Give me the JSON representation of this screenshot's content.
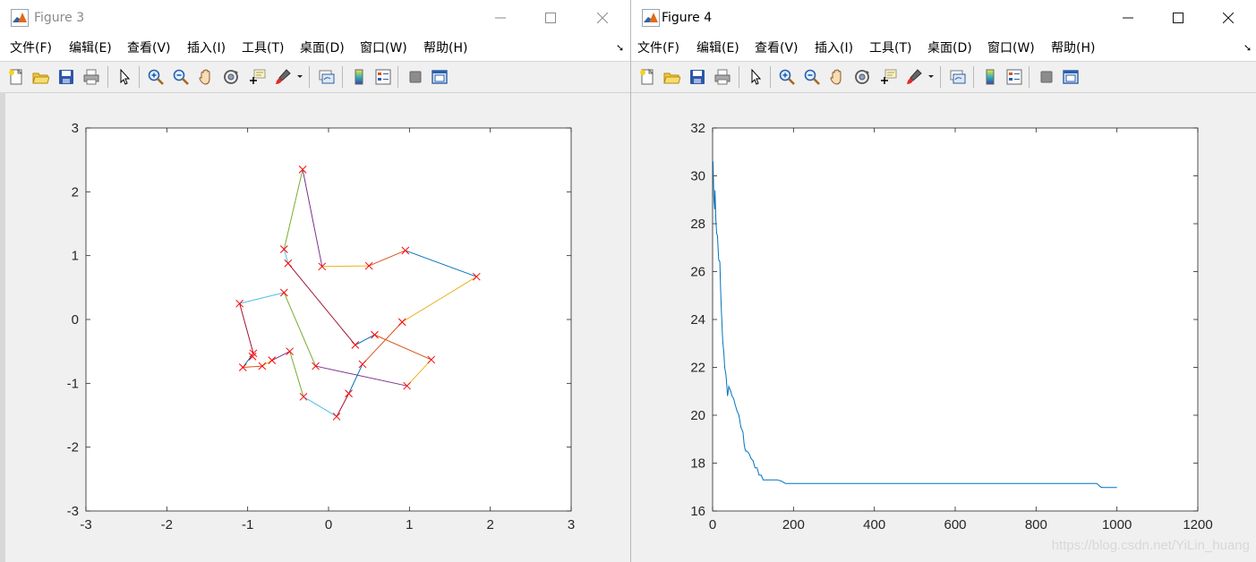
{
  "windows": [
    {
      "title": "Figure 3",
      "state": "inactive",
      "menu": [
        "文件(F)",
        "编辑(E)",
        "查看(V)",
        "插入(I)",
        "工具(T)",
        "桌面(D)",
        "窗口(W)",
        "帮助(H)"
      ]
    },
    {
      "title": "Figure 4",
      "state": "active",
      "menu": [
        "文件(F)",
        "编辑(E)",
        "查看(V)",
        "插入(I)",
        "工具(T)",
        "桌面(D)",
        "窗口(W)",
        "帮助(H)"
      ]
    }
  ],
  "toolbar_icons": [
    "new-figure-icon",
    "open-file-icon",
    "save-icon",
    "print-icon",
    "pointer-icon",
    "zoom-in-icon",
    "zoom-out-icon",
    "pan-hand-icon",
    "rotate-3d-icon",
    "data-cursor-icon",
    "brush-icon",
    "link-plot-icon",
    "colorbar-icon",
    "legend-icon",
    "hide-plot-tools-icon",
    "show-plot-tools-icon"
  ],
  "watermark": "https://blog.csdn.net/YiLin_huang",
  "chart_data": [
    {
      "type": "line",
      "figure": "Figure 3",
      "xlim": [
        -3,
        3
      ],
      "ylim": [
        -3,
        3
      ],
      "xticks": [
        -3,
        -2,
        -1,
        0,
        1,
        2,
        3
      ],
      "yticks": [
        -3,
        -2,
        -1,
        0,
        1,
        2,
        3
      ],
      "marker": "x",
      "marker_color": "#ff0000",
      "segment_colors": [
        "#0072bd",
        "#d95319",
        "#edb120",
        "#7e2f8e",
        "#77ac30",
        "#4dbeee",
        "#a2142f"
      ],
      "route": [
        [
          1.83,
          0.67
        ],
        [
          0.95,
          1.08
        ],
        [
          0.5,
          0.84
        ],
        [
          -0.08,
          0.83
        ],
        [
          -0.32,
          2.35
        ],
        [
          -0.55,
          1.1
        ],
        [
          -0.5,
          0.88
        ],
        [
          0.33,
          -0.4
        ],
        [
          0.57,
          -0.24
        ],
        [
          1.27,
          -0.63
        ],
        [
          0.97,
          -1.04
        ],
        [
          -0.16,
          -0.73
        ],
        [
          -0.55,
          0.42
        ],
        [
          -1.1,
          0.25
        ],
        [
          -0.93,
          -0.53
        ],
        [
          -1.06,
          -0.75
        ],
        [
          -0.82,
          -0.73
        ],
        [
          -0.7,
          -0.64
        ],
        [
          -0.48,
          -0.5
        ],
        [
          -0.31,
          -1.21
        ],
        [
          0.1,
          -1.52
        ],
        [
          0.25,
          -1.16
        ],
        [
          0.42,
          -0.7
        ],
        [
          0.91,
          -0.04
        ],
        [
          1.83,
          0.67
        ]
      ],
      "extra_points": [
        [
          -0.94,
          -0.58
        ]
      ]
    },
    {
      "type": "line",
      "figure": "Figure 4",
      "xlim": [
        0,
        1200
      ],
      "ylim": [
        16,
        32
      ],
      "xticks": [
        0,
        200,
        400,
        600,
        800,
        1000,
        1200
      ],
      "yticks": [
        16,
        18,
        20,
        22,
        24,
        26,
        28,
        30,
        32
      ],
      "color": "#0072bd",
      "x": [
        1,
        3,
        5,
        6,
        8,
        10,
        12,
        15,
        18,
        20,
        22,
        25,
        28,
        30,
        33,
        37,
        40,
        45,
        48,
        52,
        55,
        60,
        65,
        70,
        75,
        78,
        80,
        82,
        85,
        90,
        95,
        100,
        105,
        110,
        115,
        120,
        125,
        130,
        140,
        150,
        160,
        170,
        175,
        180,
        200,
        300,
        400,
        500,
        600,
        700,
        800,
        900,
        950,
        960,
        965,
        1000
      ],
      "y": [
        30.6,
        29.1,
        28.6,
        29.4,
        28.2,
        27.6,
        27.5,
        26.5,
        26.4,
        25.2,
        24.3,
        23.1,
        22.6,
        22.0,
        21.7,
        20.8,
        21.2,
        21.0,
        20.8,
        20.7,
        20.5,
        20.2,
        20.0,
        19.5,
        19.3,
        18.8,
        18.6,
        18.5,
        18.5,
        18.4,
        18.2,
        18.1,
        17.8,
        17.8,
        17.5,
        17.5,
        17.3,
        17.3,
        17.3,
        17.3,
        17.3,
        17.25,
        17.2,
        17.15,
        17.15,
        17.15,
        17.15,
        17.15,
        17.15,
        17.15,
        17.15,
        17.15,
        17.15,
        17.0,
        16.98,
        16.98
      ]
    }
  ]
}
